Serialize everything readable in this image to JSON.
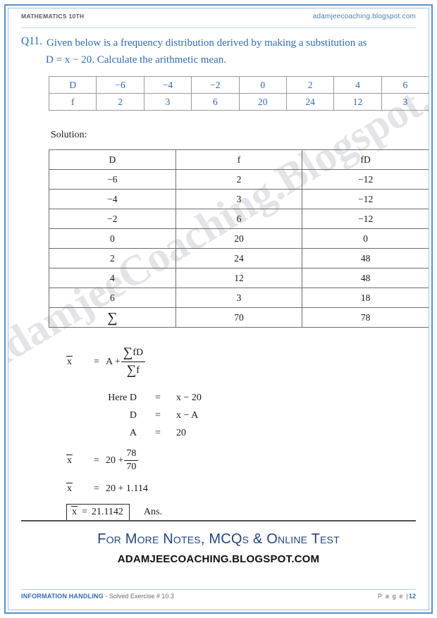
{
  "header": {
    "subject": "Mathematics 10th",
    "site": "adamjeecoaching.blogspot.com"
  },
  "watermark": {
    "text": "AdamjeeCoaching.Blogspot.com"
  },
  "question": {
    "number": "Q11.",
    "line1": "Given below is a frequency distribution derived by making a substitution as",
    "line2": "D = x − 20. Calculate the arithmetic mean."
  },
  "question_table": {
    "rows": [
      [
        "D",
        "−6",
        "−4",
        "−2",
        "0",
        "2",
        "4",
        "6"
      ],
      [
        "f",
        "2",
        "3",
        "6",
        "20",
        "24",
        "12",
        "3"
      ]
    ]
  },
  "solution": {
    "label": "Solution:"
  },
  "solution_table": {
    "headers": [
      "D",
      "f",
      "fD"
    ],
    "rows": [
      [
        "−6",
        "2",
        "−12"
      ],
      [
        "−4",
        "3",
        "−12"
      ],
      [
        "−2",
        "6",
        "−12"
      ],
      [
        "0",
        "20",
        "0"
      ],
      [
        "2",
        "24",
        "48"
      ],
      [
        "4",
        "12",
        "48"
      ],
      [
        "6",
        "3",
        "18"
      ]
    ],
    "total_row": [
      "∑",
      "70",
      "78"
    ]
  },
  "working": {
    "eq_main": {
      "lhs": "x",
      "equals": "=",
      "a_plus": "A +",
      "numerator_sigma": "∑",
      "numerator_term": "fD",
      "denominator_sigma": "∑",
      "denominator_term": "f"
    },
    "here_rows": [
      {
        "label": "Here  D",
        "equals": "=",
        "value": "x − 20"
      },
      {
        "label": "D",
        "equals": "=",
        "value": "x − A"
      },
      {
        "label": "A",
        "equals": "=",
        "value": "20"
      }
    ],
    "eq_2": {
      "lhs": "x",
      "equals": "=",
      "base": "20 +",
      "num": "78",
      "den": "70"
    },
    "eq_3": {
      "lhs": "x",
      "equals": "=",
      "value": "20 + 1.114"
    },
    "eq_ans": {
      "lhs": "x",
      "equals": "=",
      "value": "21.1142",
      "ans_word": "Ans."
    }
  },
  "promo": {
    "line1": "For More Notes, MCQs & Online Test",
    "line2": "ADAMJEECOACHING.BLOGSPOT.COM"
  },
  "footer": {
    "chapter": "INFORMATION HANDLING",
    "exercise": "- Solved Exercise # 10.3",
    "page_label": "P a g e  |",
    "page_number": "12"
  }
}
